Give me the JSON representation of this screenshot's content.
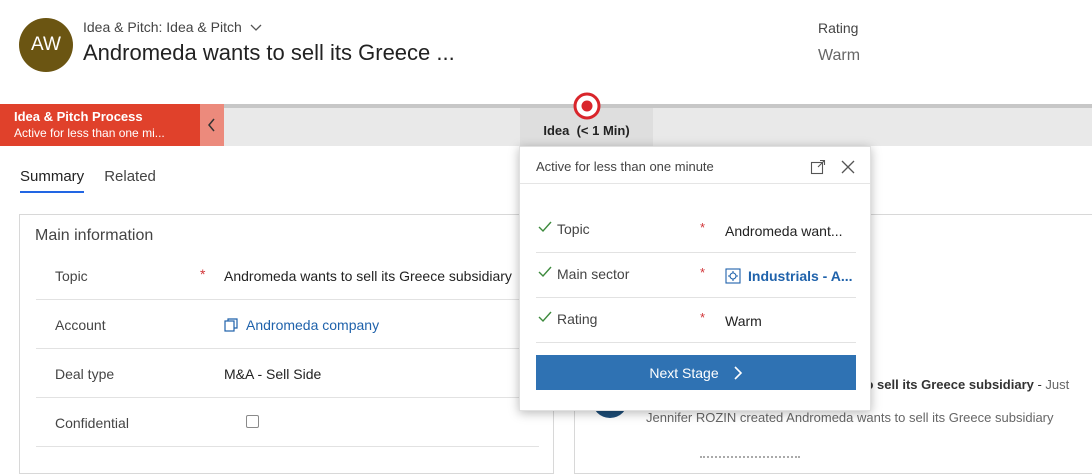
{
  "header": {
    "avatar_initials": "AW",
    "entity_label": "Idea & Pitch: Idea & Pitch",
    "record_title": "Andromeda wants to sell its Greece ...",
    "rating_label": "Rating",
    "rating_value": "Warm"
  },
  "process": {
    "name": "Idea & Pitch Process",
    "status": "Active for less than one mi...",
    "stage_label": "Idea",
    "stage_duration": "(< 1 Min)"
  },
  "tabs": [
    {
      "label": "Summary",
      "active": true
    },
    {
      "label": "Related",
      "active": false
    }
  ],
  "main_info": {
    "title": "Main information",
    "fields": [
      {
        "label": "Topic",
        "required": "*",
        "value": "Andromeda wants to sell its Greece subsidiary"
      },
      {
        "label": "Account",
        "value": "Andromeda company"
      },
      {
        "label": "Deal type",
        "value": "M&A - Sell Side"
      },
      {
        "label": "Confidential",
        "value": ""
      }
    ]
  },
  "flyout": {
    "title": "Active for less than one minute",
    "fields": [
      {
        "label": "Topic",
        "required": "*",
        "value": "Andromeda want..."
      },
      {
        "label": "Main sector",
        "required": "*",
        "value": "Industrials - A..."
      },
      {
        "label": "Rating",
        "required": "*",
        "value": "Warm"
      }
    ],
    "next_stage_label": "Next Stage"
  },
  "timeline": {
    "post_title": "ts to sell its Greece subsidiary",
    "post_sep": " - ",
    "post_time": "Just",
    "post_text": "Jennifer ROZIN created Andromeda wants to sell its Greece subsidiary"
  },
  "colors": {
    "process_active": "#e0412b",
    "accent_blue": "#2f72b3",
    "link_blue": "#1f62ab",
    "avatar_bg": "#6b5512"
  }
}
